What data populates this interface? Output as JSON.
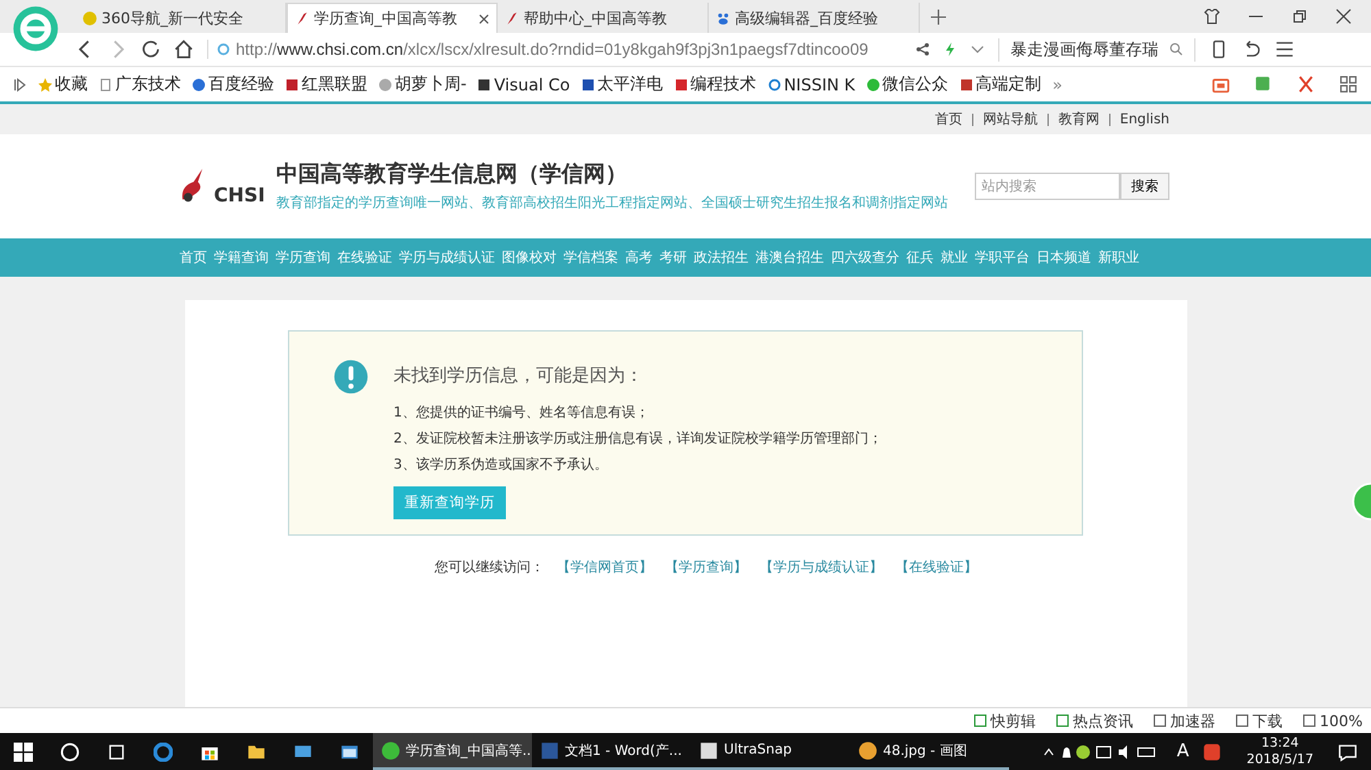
{
  "browser": {
    "tabs": [
      {
        "label": "360导航_新一代安全",
        "kind": "nav",
        "selected": false
      },
      {
        "label": "学历查询_中国高等教",
        "kind": "chsi",
        "selected": true
      },
      {
        "label": "帮助中心_中国高等教",
        "kind": "chsi",
        "selected": false
      },
      {
        "label": "高级编辑器_百度经验",
        "kind": "baidu",
        "selected": false
      }
    ],
    "address": {
      "scheme": "http://",
      "host": "www.chsi.com.cn",
      "path": "/xlcx/lscx/xlresult.do?rndid=01y8kgah9f3pj3n1paegsf7dtincoo09"
    },
    "search_hint": "暴走漫画侮辱董存瑞",
    "bookmarks": [
      {
        "label": "收藏",
        "kind": "star"
      },
      {
        "label": "广东技术",
        "kind": "page"
      },
      {
        "label": "百度经验",
        "kind": "paw"
      },
      {
        "label": "红黑联盟",
        "kind": "shield"
      },
      {
        "label": "胡萝卜周-",
        "kind": "face"
      },
      {
        "label": "Visual Co",
        "kind": "vs"
      },
      {
        "label": "太平洋电",
        "kind": "pc"
      },
      {
        "label": "编程技术",
        "kind": "c"
      },
      {
        "label": "NISSIN K",
        "kind": "ring"
      },
      {
        "label": "微信公众",
        "kind": "wechat"
      },
      {
        "label": "高端定制",
        "kind": "fox"
      }
    ],
    "more": "»"
  },
  "site": {
    "top_links": [
      "首页",
      "网站导航",
      "教育网",
      "English"
    ],
    "logo_text": "CHSI",
    "title": "中国高等教育学生信息网（学信网）",
    "subtitle": "教育部指定的学历查询唯一网站、教育部高校招生阳光工程指定网站、全国硕士研究生招生报名和调剂指定网站",
    "search": {
      "placeholder": "站内搜索",
      "button": "搜索"
    },
    "nav": [
      "首页",
      "学籍查询",
      "学历查询",
      "在线验证",
      "学历与成绩认证",
      "图像校对",
      "学信档案",
      "高考",
      "考研",
      "政法招生",
      "港澳台招生",
      "四六级查分",
      "征兵",
      "就业",
      "学职平台",
      "日本频道",
      "新职业"
    ],
    "notice": {
      "title": "未找到学历信息，可能是因为：",
      "reasons": [
        "1、您提供的证书编号、姓名等信息有误；",
        "2、发证院校暂未注册该学历或注册信息有误，详询发证院校学籍学历管理部门；",
        "3、该学历系伪造或国家不予承认。"
      ],
      "button": "重新查询学历"
    },
    "continue": {
      "label": "您可以继续访问：",
      "links": [
        "【学信网首页】",
        "【学历查询】",
        "【学历与成绩认证】",
        "【在线验证】"
      ]
    }
  },
  "status_bar": [
    "快剪辑",
    "热点资讯",
    "加速器",
    "下载",
    "100%"
  ],
  "taskbar": {
    "apps": [
      {
        "label": "学历查询_中国高等...",
        "kind": "browser",
        "selected": true
      },
      {
        "label": "文档1 - Word(产...",
        "kind": "word",
        "selected": false
      },
      {
        "label": "UltraSnap",
        "kind": "snap",
        "selected": false
      },
      {
        "label": "48.jpg - 画图",
        "kind": "paint",
        "selected": false
      }
    ],
    "ime": "A",
    "time": "13:24",
    "date": "2018/5/17"
  }
}
